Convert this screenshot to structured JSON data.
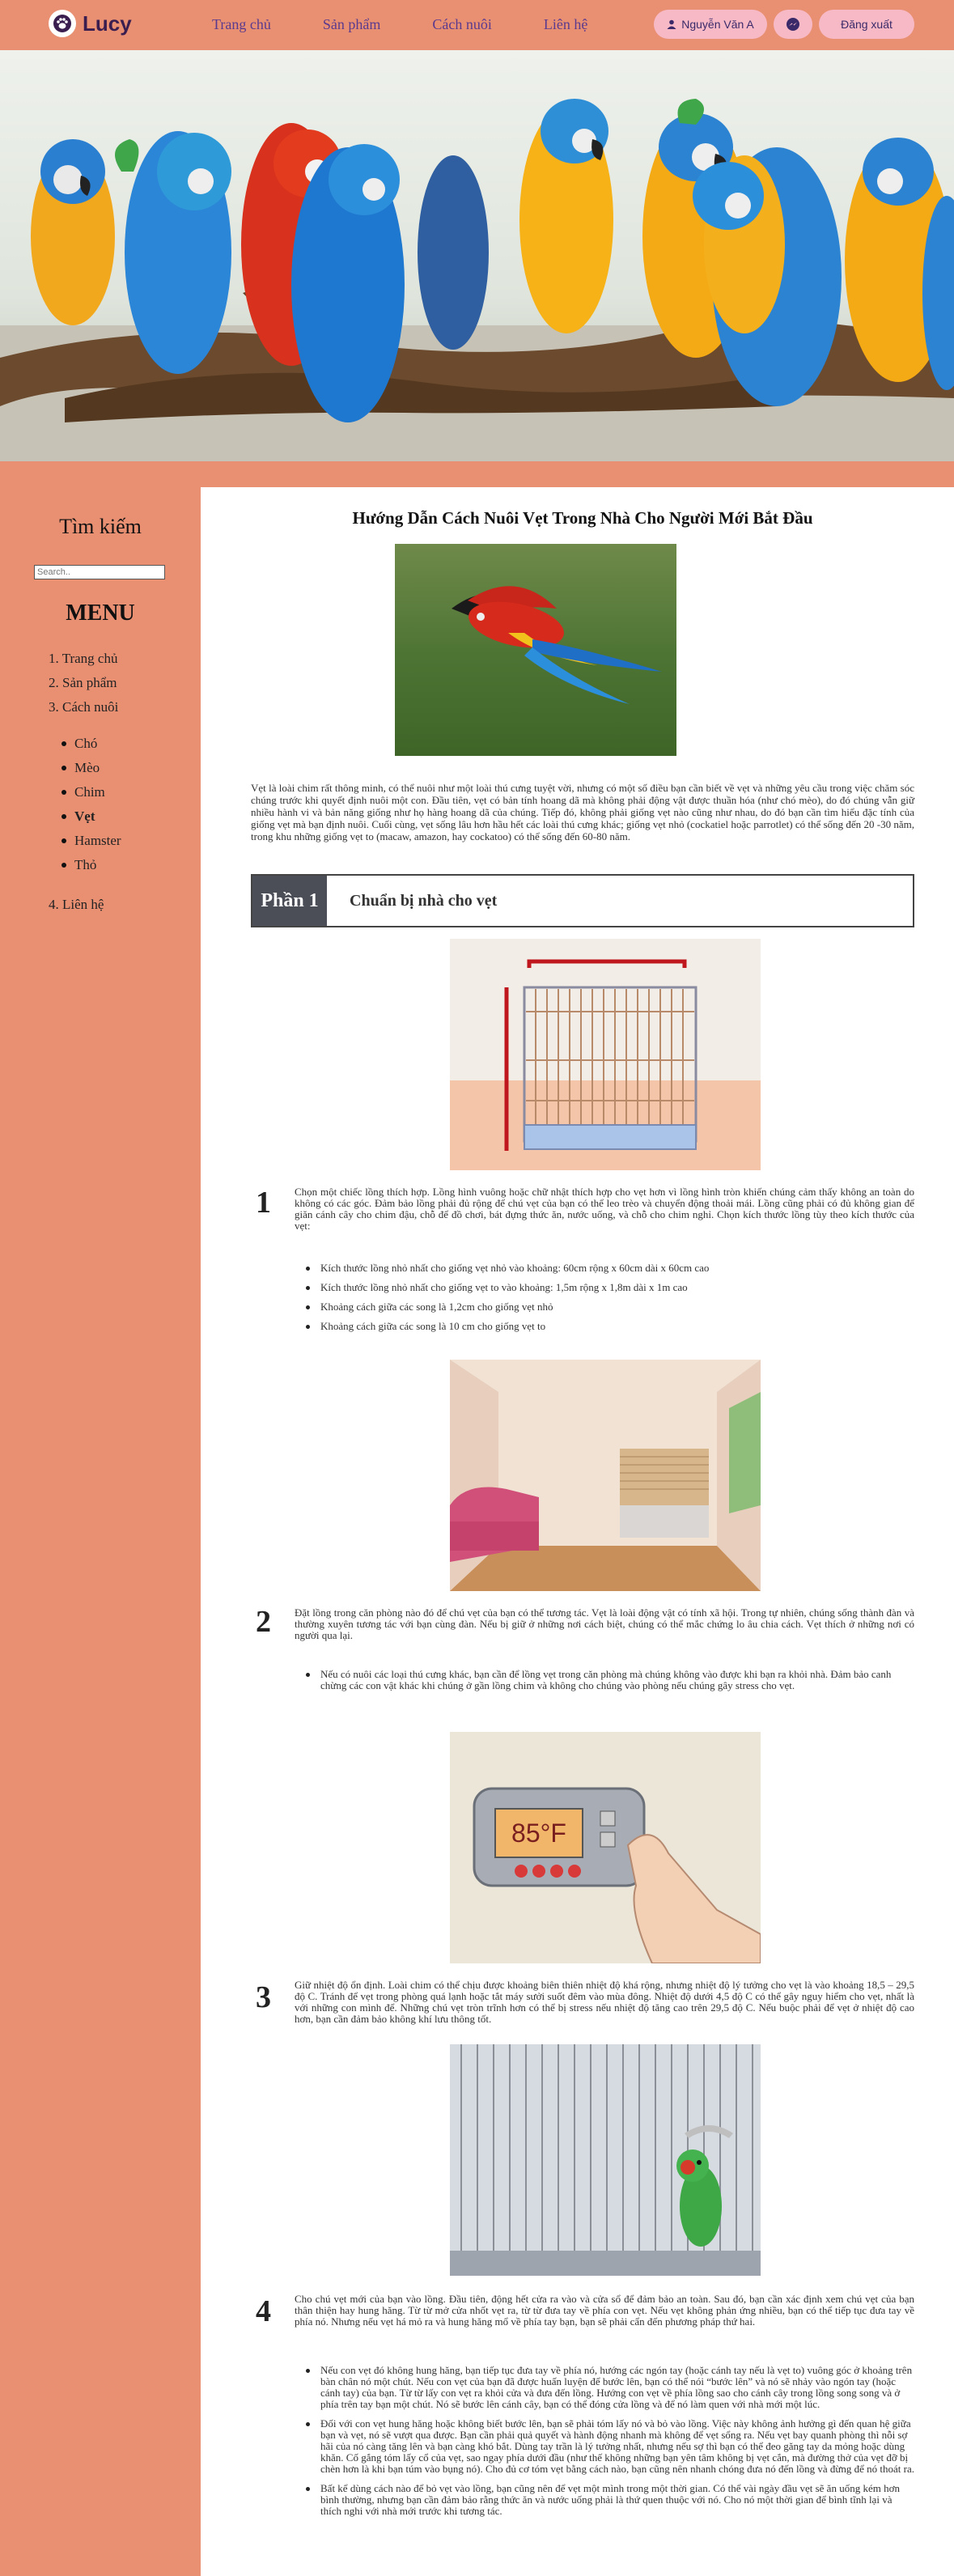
{
  "brand": {
    "name": "Lucy",
    "icon": "paw-icon"
  },
  "nav": {
    "items": [
      "Trang chủ",
      "Sản phẩm",
      "Cách nuôi",
      "Liên hệ"
    ]
  },
  "user": {
    "name": "Nguyễn Văn A",
    "user_icon": "user-icon",
    "message_icon": "messenger-icon",
    "logout_label": "Đăng xuất"
  },
  "sidebar": {
    "search_title": "Tìm kiếm",
    "search_placeholder": "Search..",
    "menu_title": "MENU",
    "items": [
      "1. Trang chủ",
      "2. Sản phẩm",
      "3. Cách nuôi"
    ],
    "sub_items": [
      "Chó",
      "Mèo",
      "Chim",
      "Vẹt",
      "Hamster",
      "Thỏ"
    ],
    "last_item": "4. Liên hệ"
  },
  "article": {
    "title": "Hướng Dẫn Cách Nuôi Vẹt Trong Nhà Cho Người Mới Bắt Đầu",
    "intro": "Vẹt là loài chim rất thông minh, có thể nuôi như một loài thú cưng tuyệt vời, nhưng có một số điều bạn cần biết về vẹt và những yêu cầu trong việc chăm sóc chúng trước khi quyết định nuôi một con. Đầu tiên, vẹt có bản tính hoang dã mà không phải động vật được thuần hóa (như chó mèo), do đó chúng vẫn giữ nhiều hành vi và bản năng giống như họ hàng hoang dã của chúng. Tiếp đó, không phải giống vẹt nào cũng như nhau, do đó bạn cần tìm hiểu đặc tính của giống vẹt mà bạn định nuôi. Cuối cùng, vẹt sống lâu hơn hầu hết các loài thú cưng khác; giống vẹt nhỏ (cockatiel hoặc parrotlet) có thể sống đến 20 -30 năm, trong khu những giống vẹt to (macaw, amazon, hay cockatoo) có thể sống đến 60-80 năm.",
    "part_label": "Phần 1",
    "part_name": "Chuẩn bị nhà cho vẹt",
    "steps": [
      {
        "number": "1",
        "text": "Chọn một chiếc lồng thích hợp. Lồng hình vuông hoặc chữ nhật thích hợp cho vẹt hơn vì lồng hình tròn khiến chúng cảm thấy không an toàn do không có các góc. Đảm bảo lồng phải đủ rộng để chú vẹt của bạn có thể leo trèo và chuyển động thoải mái. Lồng cũng phải có đủ không gian để giăn cánh cây cho chim đậu, chỗ để đồ chơi, bát đựng thức ăn, nước uống, và chỗ cho chim nghỉ. Chọn kích thước lồng tùy theo kích thước của vẹt:",
        "bullets": [
          "Kích thước lồng nhỏ nhất cho giống vẹt nhỏ vào khoảng: 60cm rộng x 60cm dài x 60cm cao",
          "Kích thước lồng nhỏ nhất cho giống vẹt to vào khoảng: 1,5m rộng x 1,8m dài x 1m cao",
          "Khoảng cách giữa các song là 1,2cm cho giống vẹt nhỏ",
          "Khoảng cách giữa các song là 10 cm cho giống vẹt to"
        ]
      },
      {
        "number": "2",
        "text": "Đặt lồng trong căn phòng nào đó để chú vẹt của bạn có thể tương tác. Vẹt là loài động vật có tính xã hội. Trong tự nhiên, chúng sống thành đàn và thường xuyên tương tác với bạn cùng đàn. Nếu bị giữ ở những nơi cách biệt, chúng có thể mắc chứng lo âu chia cách. Vẹt thích ở những nơi có người qua lại.",
        "bullets": [
          "Nếu có nuôi các loại thú cưng khác, bạn cần để lồng vẹt trong căn phòng mà chúng không vào được khi bạn ra khỏi nhà. Đảm bảo canh chừng các con vật khác khi chúng ở gần lồng chim và không cho chúng vào phòng nếu chúng gây stress cho vẹt."
        ]
      },
      {
        "number": "3",
        "text": "Giữ nhiệt độ ổn định. Loài chim có thể chịu được khoảng biên thiên nhiệt độ khá rộng, nhưng nhiệt độ lý tưởng cho vẹt là vào khoảng 18,5 – 29,5 độ C. Tránh để vẹt trong phòng quá lạnh hoặc tắt máy sưởi suốt đêm vào mùa đông. Nhiệt độ dưới 4,5 độ C có thể gây nguy hiểm cho vẹt, nhất là với những con mình để. Những chú vẹt tròn trĩnh hơn có thể bị stress nếu nhiệt độ tăng cao trên 29,5 độ C. Nếu buộc phải để vẹt ở nhiệt độ cao hơn, bạn cần đảm bảo không khí lưu thông tốt.",
        "thermostat_reading": "85°F",
        "bullets": []
      },
      {
        "number": "4",
        "text": "Cho chú vẹt mới của bạn vào lồng. Đầu tiên, động hết cửa ra vào và cửa sổ để đảm bảo an toàn. Sau đó, bạn cần xác định xem chú vẹt của bạn thân thiện hay hung hăng. Từ từ mở cửa nhốt vẹt ra, từ từ đưa tay về phía con vẹt. Nếu vẹt không phản ứng nhiều, bạn có thể tiếp tục đưa tay về phía nó. Nhưng nếu vẹt há mỏ ra và hung hăng mổ về phía tay bạn, bạn sẽ phải cẩn đến phương pháp thứ hai.",
        "bullets": [
          "Nếu con vẹt đó không hung hăng, bạn tiếp tục đưa tay về phía nó, hướng các ngón tay (hoặc cánh tay nếu là vẹt to) vuông góc ở khoảng trên bàn chân nó một chút. Nếu con vẹt của bạn đã được huấn luyện để bước lên, bạn có thể nói “bước lên” và nó sẽ nhảy vào ngón tay (hoặc cánh tay) của bạn. Từ từ lấy con vẹt ra khỏi cửa và đưa đến lồng. Hướng con vẹt về phía lồng sao cho cánh cây trong lồng song song và ở phía trên tay bạn một chút. Nó sẽ bước lên cánh cây, bạn có thể đóng cửa lồng và để nó làm quen với nhà mới một lúc.",
          "Đối với con vẹt hung hăng hoặc không biết bước lên, bạn sẽ phải tóm lấy nó và bỏ vào lồng. Việc này không ảnh hưởng gì đến quan hệ giữa bạn và vẹt, nó sẽ vượt qua được. Bạn cần phải quả quyết và hành động nhanh mà không để vẹt sổng ra. Nếu vẹt bay quanh phòng thì nỗi sợ hãi của nó càng tăng lên và bạn càng khó bắt. Dùng tay trần là lý tưởng nhất, nhưng nếu sợ thì bạn có thể đeo găng tay da mỏng hoặc dùng khăn. Cố gắng tóm lấy cổ của vẹt, sao ngay phía dưới đầu (như thế không những bạn yên tâm không bị vẹt cắn, mà đường thở của vẹt đỡ bị chèn hơn là khi bạn túm vào bụng nó). Cho đủ cơ tóm vẹt bằng cách nào, bạn cũng nên nhanh chóng đưa nó đến lồng và đừng để nó thoát ra.",
          "Bất kể dùng cách nào để bỏ vẹt vào lồng, bạn cũng nên để vẹt một mình trong một thời gian. Có thể vài ngày đầu vẹt sẽ ăn uống kém hơn bình thường, nhưng bạn cần đảm bảo rằng thức ăn và nước uống phải là thứ quen thuộc với nó. Cho nó một thời gian để bình tĩnh lại và thích nghi với nhà mới trước khi tương tác."
        ]
      }
    ]
  },
  "colors": {
    "page_bg": "#e99073",
    "pill_bg": "#f7b9c6",
    "nav_text": "#5a3a8e",
    "part_label_bg": "#4b4d57"
  }
}
